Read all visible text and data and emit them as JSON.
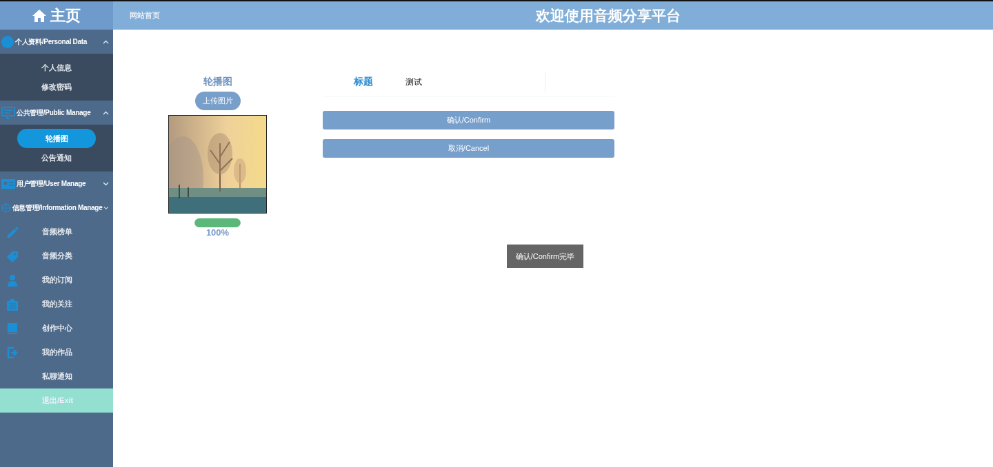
{
  "sidebar": {
    "home": "主页",
    "groups": [
      {
        "label": "个人资料/Personal Data",
        "expanded": true,
        "children": [
          {
            "label": "个人信息",
            "selected": false
          },
          {
            "label": "修改密码",
            "selected": false
          }
        ]
      },
      {
        "label": "公共管理/Public Manage",
        "expanded": true,
        "children": [
          {
            "label": "轮播图",
            "selected": true
          },
          {
            "label": "公告通知",
            "selected": false
          }
        ]
      },
      {
        "label": "用户管理/User Manage",
        "expanded": false
      },
      {
        "label": "信息管理/Information Manage",
        "expanded": false
      }
    ],
    "items": [
      {
        "label": "音频榜单"
      },
      {
        "label": "音频分类"
      },
      {
        "label": "我的订阅"
      },
      {
        "label": "我的关注"
      },
      {
        "label": "创作中心"
      },
      {
        "label": "我的作品"
      },
      {
        "label": "私聊通知"
      }
    ],
    "exit": "退出/Exit"
  },
  "header": {
    "link": "网站首页",
    "title": "欢迎使用音频分享平台"
  },
  "uploader": {
    "label": "轮播图",
    "button": "上传图片",
    "progress": {
      "level": 1,
      "reading": "100%"
    }
  },
  "form": {
    "title_label": "标题",
    "title_value": "测试",
    "buttons": [
      "确认/Confirm",
      "取消/Cancel"
    ]
  },
  "toast": "确认/Confirm完毕"
}
